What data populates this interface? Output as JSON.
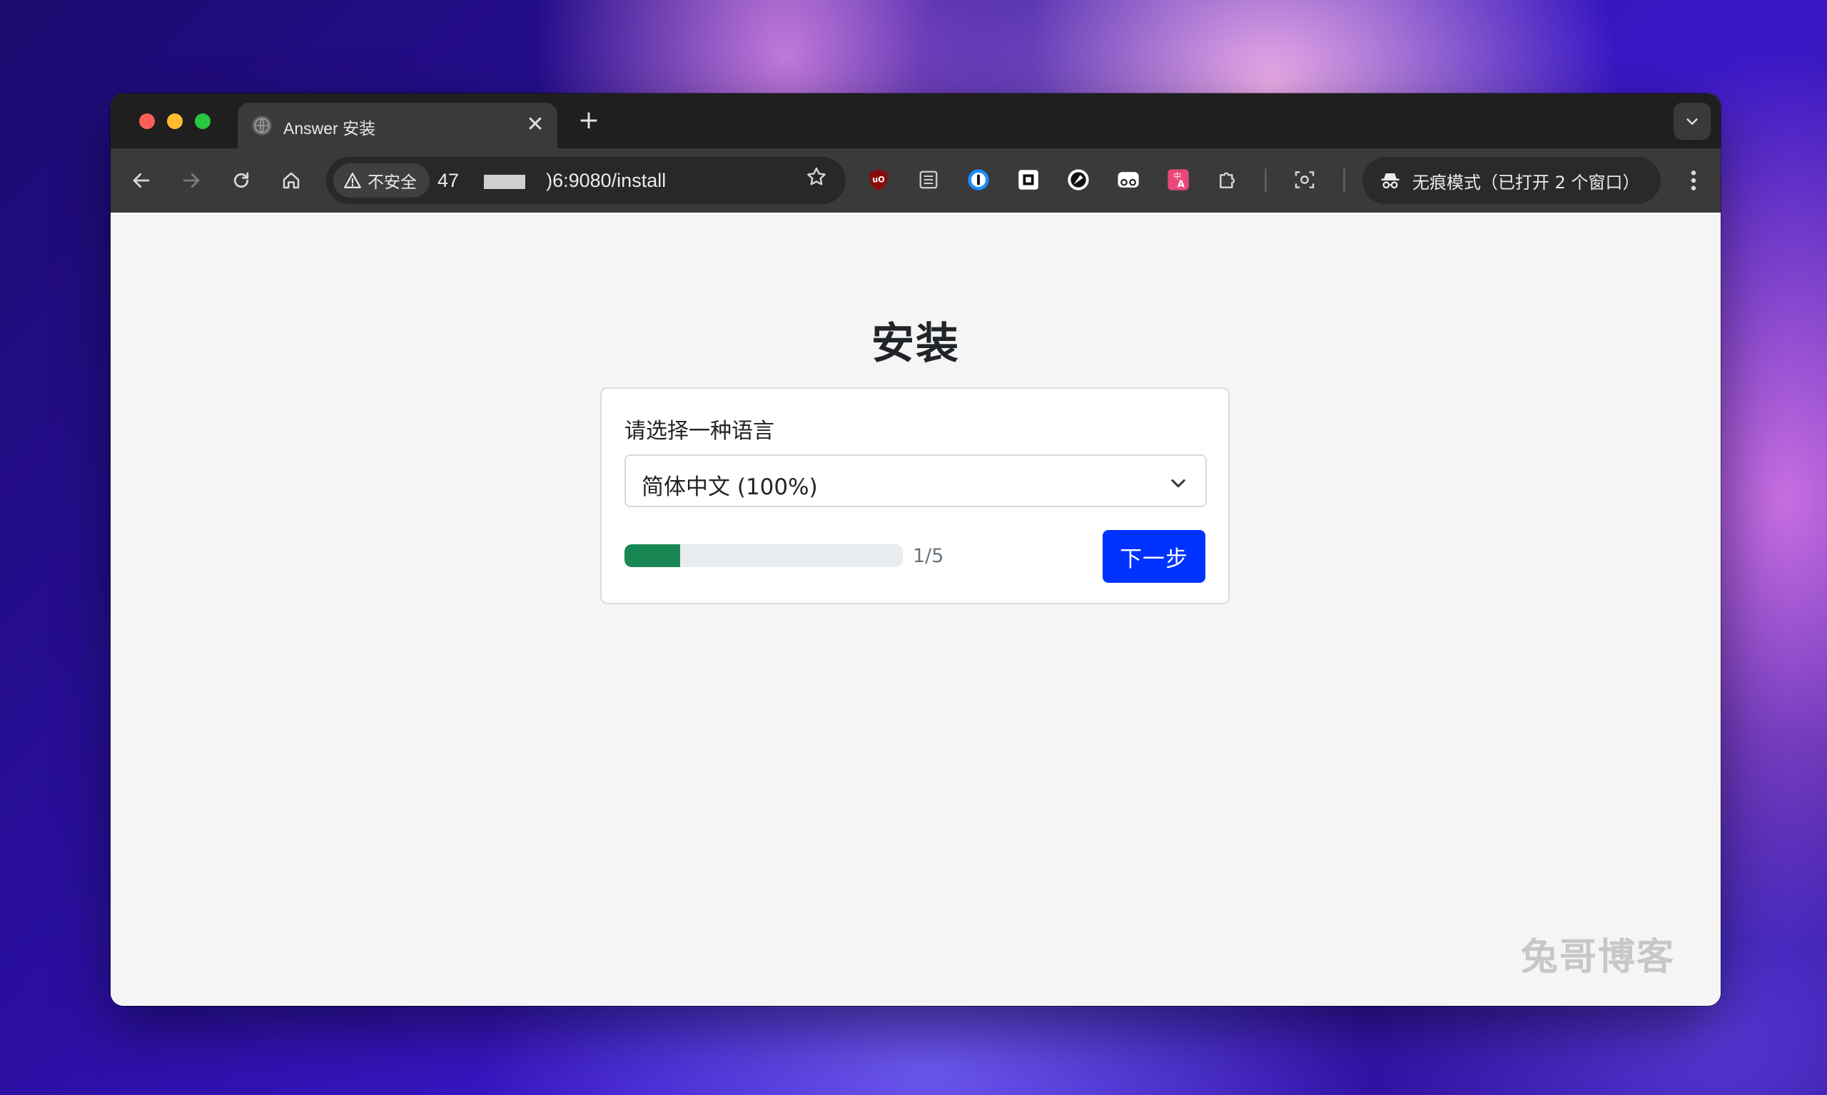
{
  "browser": {
    "tab": {
      "title": "Answer 安装",
      "close_label": "✕"
    },
    "new_tab_label": "+",
    "address_bar": {
      "security_label": "不安全",
      "url_prefix": "47",
      "url_suffix": ")6:9080/install"
    },
    "incognito_label": "无痕模式（已打开 2 个窗口）",
    "extensions": [
      "ublock-origin-icon",
      "reader-icon",
      "1password-icon",
      "square-icon",
      "compass-icon",
      "mask-icon",
      "translate-icon",
      "puzzle-icon",
      "screenshot-icon"
    ]
  },
  "page": {
    "title": "安装",
    "form": {
      "label": "请选择一种语言",
      "language_selected": "简体中文 (100%)",
      "progress_fraction": 0.2,
      "progress_text": "1/5",
      "next_label": "下一步"
    }
  },
  "watermark": "兔哥博客",
  "colors": {
    "primary_button": "#0033ff",
    "progress_fill": "#198754",
    "tab_bar": "#1f1f1f",
    "toolbar": "#3a3a3a"
  }
}
